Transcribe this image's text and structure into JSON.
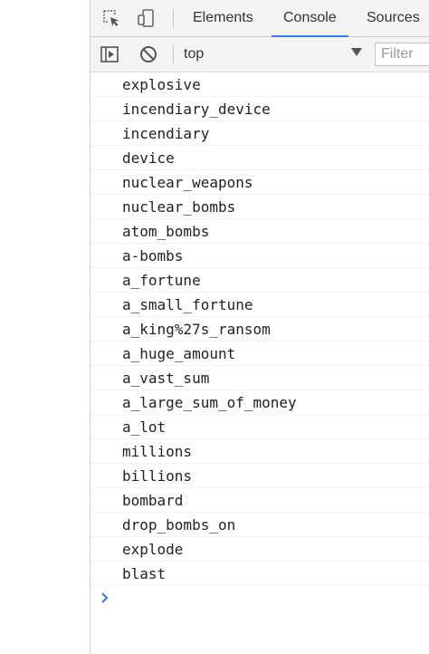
{
  "devtools": {
    "tabs": [
      {
        "label": "Elements"
      },
      {
        "label": "Console"
      },
      {
        "label": "Sources"
      }
    ],
    "active_tab": "Console",
    "accent_color": "#3879d9"
  },
  "toolbar": {
    "context": "top",
    "filter_placeholder": "Filter"
  },
  "console": {
    "messages": [
      "explosive",
      "incendiary_device",
      "incendiary",
      "device",
      "nuclear_weapons",
      "nuclear_bombs",
      "atom_bombs",
      "a-bombs",
      "a_fortune",
      "a_small_fortune",
      "a_king%27s_ransom",
      "a_huge_amount",
      "a_vast_sum",
      "a_large_sum_of_money",
      "a_lot",
      "millions",
      "billions",
      "bombard",
      "drop_bombs_on",
      "explode",
      "blast"
    ],
    "prompt_color": "#3879d9"
  },
  "icons": {
    "inspect": "inspect-element-icon",
    "device": "device-toolbar-icon",
    "sidebar": "show-sidebar-icon",
    "clear": "clear-console-icon",
    "dropdown": "chevron-down-icon",
    "prompt": "chevron-right-icon"
  }
}
